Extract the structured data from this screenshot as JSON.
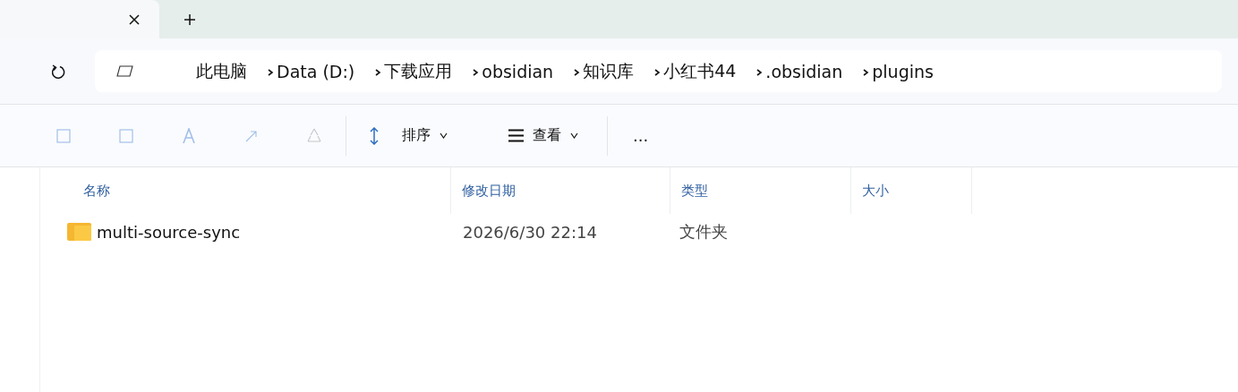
{
  "breadcrumb": [
    "此电脑",
    "Data (D:)",
    "下载应用",
    "obsidian",
    "知识库",
    "小红书44",
    ".obsidian",
    "plugins"
  ],
  "toolbar": {
    "actions": [
      {
        "kind": "new",
        "disabled": true
      },
      {
        "kind": "copy",
        "disabled": true
      },
      {
        "kind": "rename",
        "disabled": true
      },
      {
        "kind": "share",
        "disabled": true
      },
      {
        "kind": "delete",
        "disabled": true
      }
    ],
    "sort": {
      "label": "排序"
    },
    "view": {
      "label": "查看"
    },
    "more": "..."
  },
  "table": {
    "columns": [
      "名称",
      "修改日期",
      "类型",
      "大小"
    ],
    "rows": [
      {
        "name": "multi-source-sync",
        "modified": "2026/6/30 22:14",
        "type": "文件夹"
      }
    ]
  }
}
